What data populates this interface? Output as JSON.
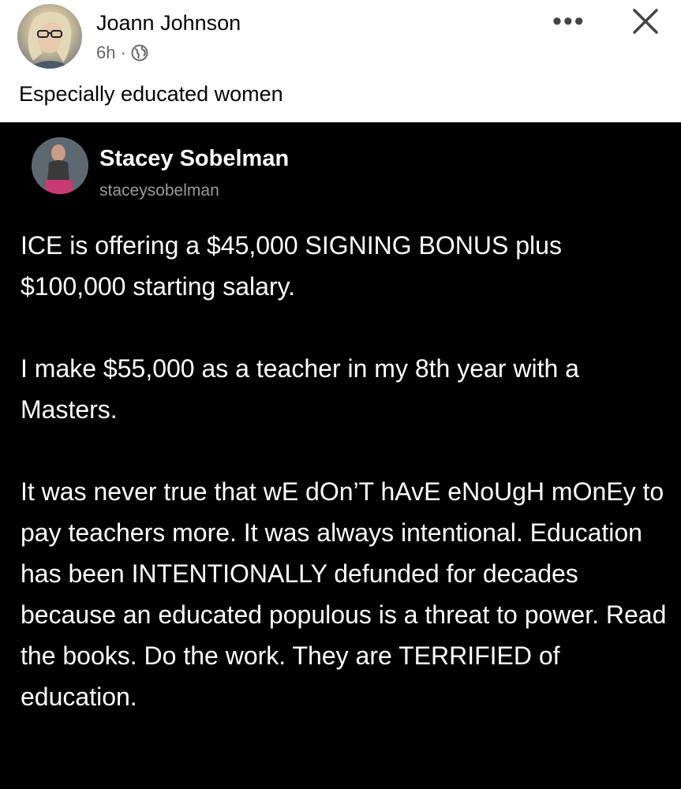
{
  "outer_post": {
    "author": "Joann Johnson",
    "time": "6h",
    "separator": "·",
    "audience_icon": "globe-icon",
    "caption": "Especially educated women",
    "more_icon": "more-options-icon",
    "close_icon": "close-icon"
  },
  "inner_post": {
    "name": "Stacey Sobelman",
    "handle": "staceysobelman",
    "paragraphs": [
      "ICE is offering a $45,000 SIGNING BONUS plus $100,000 starting salary.",
      "I make $55,000 as a teacher in my 8th year with a Masters.",
      "It was never true that wE dOn’T hAvE eNoUgH mOnEy to pay teachers more. It was always intentional. Education has been INTENTIONALLY defunded for decades because an educated populous is a threat to power. Read the books. Do the work. They are TERRIFIED of education."
    ]
  },
  "colors": {
    "header_bg": "#ffffff",
    "post_bg": "#000000",
    "meta_text": "#65676b",
    "handle_text": "#9a9a9a"
  }
}
